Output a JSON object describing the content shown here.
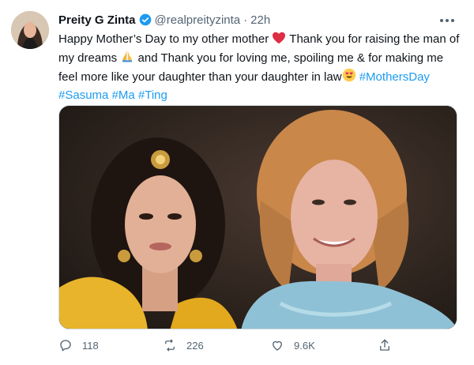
{
  "tweet": {
    "author_name": "Preity G Zinta",
    "handle": "@realpreityzinta",
    "separator": "·",
    "time": "22h",
    "text_part1": "Happy Mother’s Day to my other mother",
    "text_part2": " Thank you for raising the man of my dreams",
    "text_part3": " and Thank you for loving me, spoiling me & for making me feel more like your daughter than your daughter in law",
    "hashtags": [
      "#MothersDay",
      "#Sasuma",
      "#Ma",
      "#Ting"
    ],
    "emoji": [
      "red-heart",
      "folded-hands",
      "heart-eyes-face"
    ]
  },
  "actions": {
    "reply_count": "118",
    "retweet_count": "226",
    "like_count": "9.6K"
  },
  "icons": [
    "verified-badge-icon",
    "more-icon",
    "reply-icon",
    "retweet-icon",
    "like-icon",
    "share-icon"
  ],
  "colors": {
    "accent": "#1d9bf0",
    "text": "#0f1419",
    "muted": "#536471",
    "heart": "#e0245e"
  }
}
